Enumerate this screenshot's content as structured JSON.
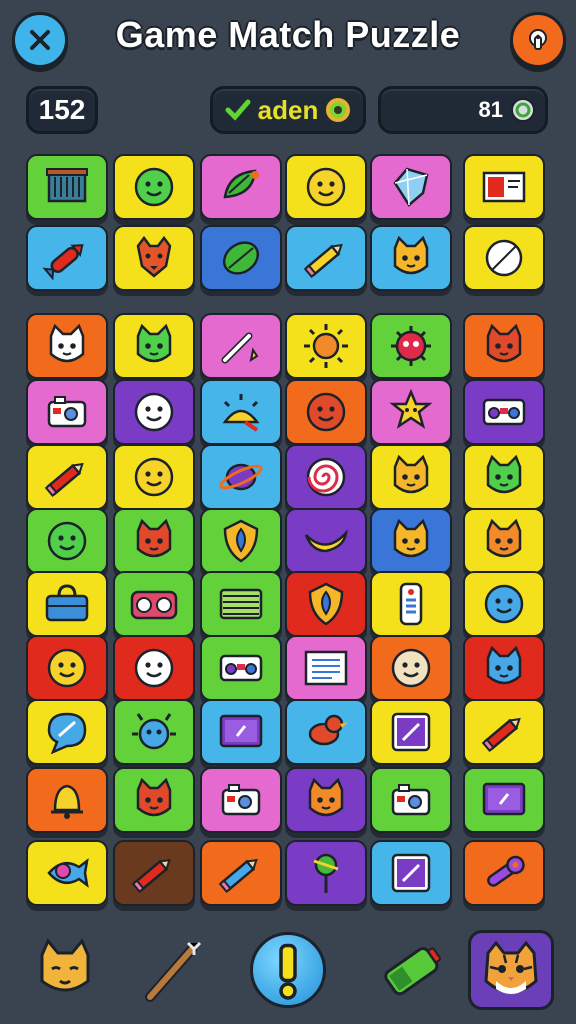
{
  "header": {
    "title": "Game Match Puzzle",
    "menu_icon": "close-x-icon",
    "help_icon": "lock-help-icon"
  },
  "stats": {
    "score": "152",
    "player_name": "aden",
    "coins": "81"
  },
  "colors": {
    "background": "#3a4350",
    "lime": "#62d13a",
    "yellow": "#f4e11b",
    "pink": "#e46ad0",
    "sky": "#46b5ea",
    "blue": "#3a76d8",
    "orange": "#f26a1b",
    "red": "#e02a1e",
    "purple": "#7a3cc4",
    "brown": "#6a3a1e"
  },
  "board": {
    "rows": [
      [
        {
          "color": "lime",
          "icon": "crate"
        },
        {
          "color": "yellow",
          "icon": "green-face"
        },
        {
          "color": "pink",
          "icon": "leaf-bird"
        },
        {
          "color": "yellow",
          "icon": "yellow-face"
        },
        {
          "color": "pink",
          "icon": "diamond"
        },
        {
          "color": "yellow",
          "icon": "card"
        }
      ],
      [
        {
          "color": "sky",
          "icon": "rocket"
        },
        {
          "color": "yellow",
          "icon": "fox"
        },
        {
          "color": "blue",
          "icon": "leaf"
        },
        {
          "color": "sky",
          "icon": "pencil"
        },
        {
          "color": "sky",
          "icon": "cat-face"
        },
        {
          "color": "yellow",
          "icon": "compass"
        }
      ],
      [
        {
          "color": "orange",
          "icon": "white-cat"
        },
        {
          "color": "yellow",
          "icon": "green-cat"
        },
        {
          "color": "pink",
          "icon": "wand"
        },
        {
          "color": "yellow",
          "icon": "sun"
        },
        {
          "color": "lime",
          "icon": "virus"
        },
        {
          "color": "orange",
          "icon": "red-cat"
        }
      ],
      [
        {
          "color": "pink",
          "icon": "camera"
        },
        {
          "color": "purple",
          "icon": "white-face"
        },
        {
          "color": "sky",
          "icon": "sunrise"
        },
        {
          "color": "orange",
          "icon": "red-blob"
        },
        {
          "color": "pink",
          "icon": "star-face"
        },
        {
          "color": "purple",
          "icon": "radio"
        }
      ],
      [
        {
          "color": "yellow",
          "icon": "red-pencil"
        },
        {
          "color": "yellow",
          "icon": "yellow-face"
        },
        {
          "color": "sky",
          "icon": "planet"
        },
        {
          "color": "purple",
          "icon": "spiral"
        },
        {
          "color": "yellow",
          "icon": "cat-face"
        },
        {
          "color": "yellow",
          "icon": "green-cat"
        }
      ],
      [
        {
          "color": "lime",
          "icon": "green-ball"
        },
        {
          "color": "lime",
          "icon": "red-cat"
        },
        {
          "color": "lime",
          "icon": "shield"
        },
        {
          "color": "purple",
          "icon": "banana"
        },
        {
          "color": "blue",
          "icon": "cat-face"
        },
        {
          "color": "yellow",
          "icon": "orange-cat"
        }
      ],
      [
        {
          "color": "yellow",
          "icon": "bag"
        },
        {
          "color": "lime",
          "icon": "boombox"
        },
        {
          "color": "lime",
          "icon": "stripes"
        },
        {
          "color": "red",
          "icon": "shield"
        },
        {
          "color": "yellow",
          "icon": "remote"
        },
        {
          "color": "yellow",
          "icon": "blue-face"
        }
      ],
      [
        {
          "color": "red",
          "icon": "yellow-face"
        },
        {
          "color": "red",
          "icon": "white-face"
        },
        {
          "color": "lime",
          "icon": "radio"
        },
        {
          "color": "pink",
          "icon": "note"
        },
        {
          "color": "orange",
          "icon": "cream-face"
        },
        {
          "color": "red",
          "icon": "blue-cat"
        }
      ],
      [
        {
          "color": "yellow",
          "icon": "chat"
        },
        {
          "color": "lime",
          "icon": "blue-bug"
        },
        {
          "color": "sky",
          "icon": "tv"
        },
        {
          "color": "sky",
          "icon": "red-bird"
        },
        {
          "color": "yellow",
          "icon": "frame"
        },
        {
          "color": "yellow",
          "icon": "red-pencil"
        }
      ],
      [
        {
          "color": "orange",
          "icon": "bell"
        },
        {
          "color": "lime",
          "icon": "red-cat"
        },
        {
          "color": "pink",
          "icon": "camera"
        },
        {
          "color": "purple",
          "icon": "orange-cat"
        },
        {
          "color": "lime",
          "icon": "camera"
        },
        {
          "color": "lime",
          "icon": "tv"
        }
      ],
      [
        {
          "color": "yellow",
          "icon": "fish"
        },
        {
          "color": "brown",
          "icon": "red-pencil"
        },
        {
          "color": "orange",
          "icon": "blue-pencil"
        },
        {
          "color": "purple",
          "icon": "pin"
        },
        {
          "color": "sky",
          "icon": "frame"
        },
        {
          "color": "orange",
          "icon": "wrench"
        }
      ]
    ]
  },
  "bottom_bar": [
    {
      "name": "cat-sleep-icon"
    },
    {
      "name": "wand-icon"
    },
    {
      "name": "hint-button",
      "label": "!"
    },
    {
      "name": "battery-icon"
    },
    {
      "name": "tiger-avatar"
    }
  ]
}
